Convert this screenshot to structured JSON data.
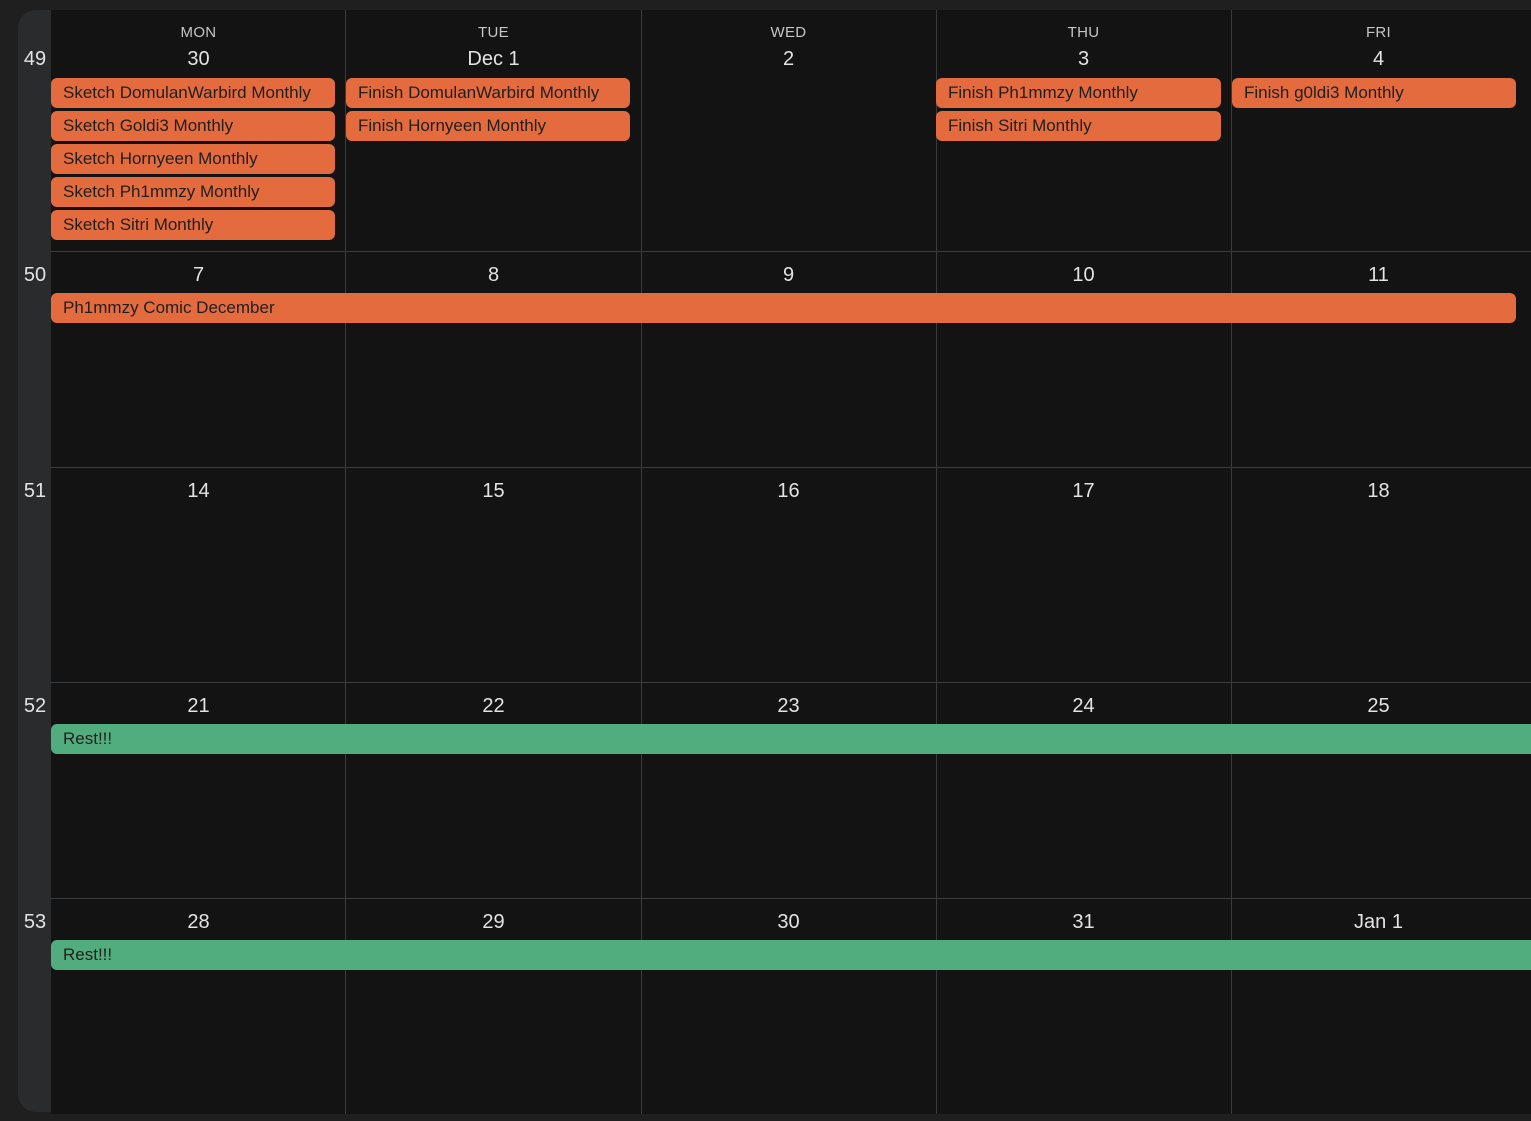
{
  "colors": {
    "orange_event": "#e36b3e",
    "green_event": "#52ad7e",
    "background": "#131314"
  },
  "day_names": [
    "MON",
    "TUE",
    "WED",
    "THU",
    "FRI"
  ],
  "weeks": [
    {
      "week_number": "49",
      "days": [
        "30",
        "Dec 1",
        "2",
        "3",
        "4"
      ],
      "events": [
        {
          "label": "Sketch DomulanWarbird Monthly",
          "color": "orange"
        },
        {
          "label": "Sketch Goldi3 Monthly",
          "color": "orange"
        },
        {
          "label": "Sketch Hornyeen Monthly",
          "color": "orange"
        },
        {
          "label": "Sketch Ph1mmzy Monthly",
          "color": "orange"
        },
        {
          "label": "Sketch Sitri Monthly",
          "color": "orange"
        },
        {
          "label": "Finish DomulanWarbird Monthly",
          "color": "orange"
        },
        {
          "label": "Finish Hornyeen Monthly",
          "color": "orange"
        },
        {
          "label": "Finish Ph1mmzy Monthly",
          "color": "orange"
        },
        {
          "label": "Finish Sitri Monthly",
          "color": "orange"
        },
        {
          "label": "Finish g0ldi3 Monthly",
          "color": "orange"
        }
      ]
    },
    {
      "week_number": "50",
      "days": [
        "7",
        "8",
        "9",
        "10",
        "11"
      ],
      "events": [
        {
          "label": "Ph1mmzy Comic December",
          "color": "orange"
        }
      ]
    },
    {
      "week_number": "51",
      "days": [
        "14",
        "15",
        "16",
        "17",
        "18"
      ],
      "events": []
    },
    {
      "week_number": "52",
      "days": [
        "21",
        "22",
        "23",
        "24",
        "25"
      ],
      "events": [
        {
          "label": "Rest!!!",
          "color": "green"
        }
      ]
    },
    {
      "week_number": "53",
      "days": [
        "28",
        "29",
        "30",
        "31",
        "Jan 1"
      ],
      "events": [
        {
          "label": "Rest!!!",
          "color": "green"
        }
      ]
    }
  ]
}
